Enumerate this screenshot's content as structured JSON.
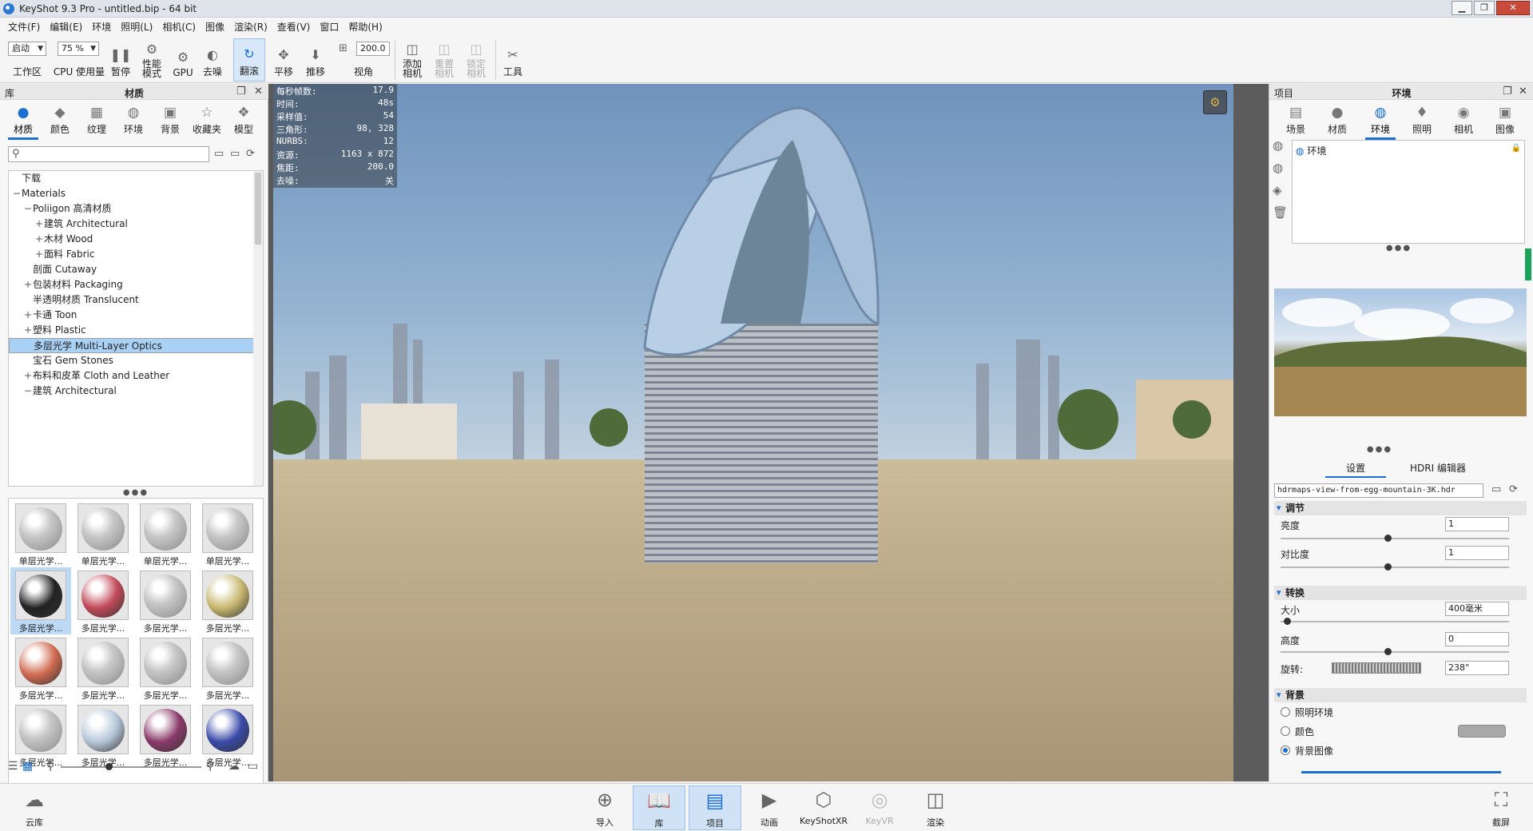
{
  "window": {
    "title": "KeyShot 9.3 Pro  - untitled.bip  - 64 bit"
  },
  "menu": [
    "文件(F)",
    "编辑(E)",
    "环境",
    "照明(L)",
    "相机(C)",
    "图像",
    "渲染(R)",
    "查看(V)",
    "窗口",
    "帮助(H)"
  ],
  "toolbar": {
    "workspace_select": "启动",
    "workspace_label": "工作区",
    "cpu_select": "75 %",
    "cpu_label": "CPU 使用量",
    "pause": "暂停",
    "perf_mode": "性能\n模式",
    "gpu": "GPU",
    "denoise": "去噪",
    "tumble": "翻滚",
    "pan": "平移",
    "dolly": "推移",
    "fov_value": "200.0",
    "fov_label": "视角",
    "add_camera": "添加\n相机",
    "reset_camera": "重置\n相机",
    "lock_camera": "锁定\n相机",
    "tools": "工具"
  },
  "library": {
    "panel_label": "库",
    "panel_title": "材质",
    "tabs": [
      "材质",
      "颜色",
      "纹理",
      "环境",
      "背景",
      "收藏夹",
      "模型"
    ],
    "active_tab": "材质",
    "tree": [
      {
        "label": "下载",
        "indent": 0,
        "exp": ""
      },
      {
        "label": "Materials",
        "indent": 0,
        "exp": "−"
      },
      {
        "label": "Poliigon 高清材质",
        "indent": 1,
        "exp": "−"
      },
      {
        "label": "建筑 Architectural",
        "indent": 2,
        "exp": "+"
      },
      {
        "label": "木材 Wood",
        "indent": 2,
        "exp": "+"
      },
      {
        "label": "面料 Fabric",
        "indent": 2,
        "exp": "+"
      },
      {
        "label": "剖面 Cutaway",
        "indent": 1,
        "exp": ""
      },
      {
        "label": "包装材料 Packaging",
        "indent": 1,
        "exp": "+"
      },
      {
        "label": "半透明材质 Translucent",
        "indent": 1,
        "exp": ""
      },
      {
        "label": "卡通 Toon",
        "indent": 1,
        "exp": "+"
      },
      {
        "label": "塑料 Plastic",
        "indent": 1,
        "exp": "+"
      },
      {
        "label": "多层光学 Multi-Layer Optics",
        "indent": 1,
        "exp": "",
        "selected": true
      },
      {
        "label": "宝石 Gem Stones",
        "indent": 1,
        "exp": ""
      },
      {
        "label": "布料和皮革 Cloth and Leather",
        "indent": 1,
        "exp": "+"
      },
      {
        "label": "建筑 Architectural",
        "indent": 1,
        "exp": "−"
      }
    ],
    "thumbnails": [
      "单层光学...",
      "单层光学...",
      "单层光学...",
      "单层光学...",
      "多层光学...",
      "多层光学...",
      "多层光学...",
      "多层光学...",
      "多层光学...",
      "多层光学...",
      "多层光学...",
      "多层光学...",
      "多层光学...",
      "多层光学...",
      "多层光学...",
      "多层光学..."
    ]
  },
  "stats": [
    {
      "label": "每秒帧数:",
      "value": "17.9"
    },
    {
      "label": "时间:",
      "value": "48s"
    },
    {
      "label": "采样值:",
      "value": "54"
    },
    {
      "label": "三角形:",
      "value": "98, 328"
    },
    {
      "label": "NURBS:",
      "value": "12"
    },
    {
      "label": "资源:",
      "value": "1163 x 872"
    },
    {
      "label": "焦距:",
      "value": "200.0"
    },
    {
      "label": "去噪:",
      "value": "关"
    }
  ],
  "project": {
    "panel_label": "项目",
    "panel_title": "环境",
    "tabs": [
      "场景",
      "材质",
      "环境",
      "照明",
      "相机",
      "图像"
    ],
    "active_tab": "环境",
    "env_item": "环境",
    "subtabs": [
      "设置",
      "HDRI 编辑器"
    ],
    "hdr_file": "hdrmaps-view-from-egg-mountain-3K.hdr",
    "adjust": {
      "title": "调节",
      "brightness_label": "亮度",
      "brightness": "1",
      "contrast_label": "对比度",
      "contrast": "1"
    },
    "transform": {
      "title": "转换",
      "size_label": "大小",
      "size": "400毫米",
      "height_label": "高度",
      "height": "0",
      "rotation_label": "旋转:",
      "rotation": "238°"
    },
    "background": {
      "title": "背景",
      "opt1": "照明环境",
      "opt2": "颜色",
      "opt3": "背景图像",
      "selected": "背景图像"
    }
  },
  "bottom": {
    "cloud": "云库",
    "import": "导入",
    "library": "库",
    "project": "项目",
    "animation": "动画",
    "keyshotxr": "KeyShotXR",
    "keyvr": "KeyVR",
    "render": "渲染",
    "screenshot": "截屏"
  }
}
